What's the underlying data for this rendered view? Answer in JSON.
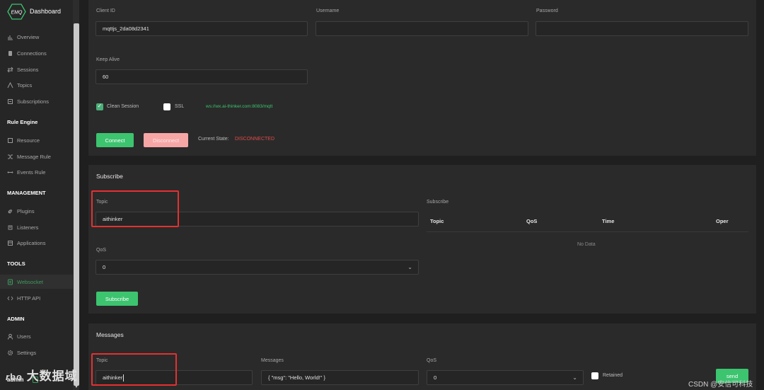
{
  "sidebar": {
    "logo_text": "EMQ",
    "title": "Dashboard",
    "items": [
      {
        "label": "Overview",
        "icon": "bar-chart-icon"
      },
      {
        "label": "Connections",
        "icon": "database-icon"
      },
      {
        "label": "Sessions",
        "icon": "swap-icon"
      },
      {
        "label": "Topics",
        "icon": "topic-icon"
      },
      {
        "label": "Subscriptions",
        "icon": "list-icon"
      },
      {
        "label": "Resource",
        "icon": "resource-icon"
      },
      {
        "label": "Message Rule",
        "icon": "shuffle-icon"
      },
      {
        "label": "Events Rule",
        "icon": "events-icon"
      },
      {
        "label": "Plugins",
        "icon": "plug-icon"
      },
      {
        "label": "Listeners",
        "icon": "listener-icon"
      },
      {
        "label": "Applications",
        "icon": "app-icon"
      },
      {
        "label": "Websocket",
        "icon": "websocket-icon"
      },
      {
        "label": "HTTP API",
        "icon": "code-icon"
      },
      {
        "label": "Users",
        "icon": "user-icon"
      },
      {
        "label": "Settings",
        "icon": "gear-icon"
      }
    ],
    "sections": [
      "Rule Engine",
      "MANAGEMENT",
      "TOOLS",
      "ADMIN"
    ],
    "user": "admin",
    "active_item": "Websocket"
  },
  "connection": {
    "client_id_label": "Client ID",
    "client_id_value": "mqttjs_2da08d2341",
    "username_label": "Username",
    "username_value": "",
    "password_label": "Password",
    "password_value": "",
    "keepalive_label": "Keep Alive",
    "keepalive_value": "60",
    "clean_session_label": "Clean Session",
    "clean_session_checked": true,
    "ssl_label": "SSL",
    "ssl_checked": false,
    "url": "ws://wx.ai-thinker.com:8083/mqtt",
    "connect_label": "Connect",
    "disconnect_label": "Disconnect",
    "state_label": "Current State:",
    "state_value": "DISCONNECTED"
  },
  "subscribe": {
    "title": "Subscribe",
    "topic_label": "Topic",
    "topic_value": "aithinker",
    "qos_label": "QoS",
    "qos_value": "0",
    "button_label": "Subscribe",
    "list_title": "Subscribe",
    "columns": [
      "Topic",
      "QoS",
      "Time",
      "Oper"
    ],
    "empty_text": "No Data"
  },
  "messages": {
    "title": "Messages",
    "topic_label": "Topic",
    "topic_value": "aithinker",
    "messages_label": "Messages",
    "messages_value": "{ \"msg\": \"Hello, World!\" }",
    "qos_label": "QoS",
    "qos_value": "0",
    "retained_label": "Retained",
    "retained_checked": false,
    "send_label": "send"
  },
  "watermarks": {
    "logo": "大数据域",
    "csdn": "CSDN @安信可科技"
  },
  "colors": {
    "accent": "#3cc46f",
    "danger": "#e53030",
    "url": "#3cc46f",
    "disconnected": "#e04b4b"
  }
}
